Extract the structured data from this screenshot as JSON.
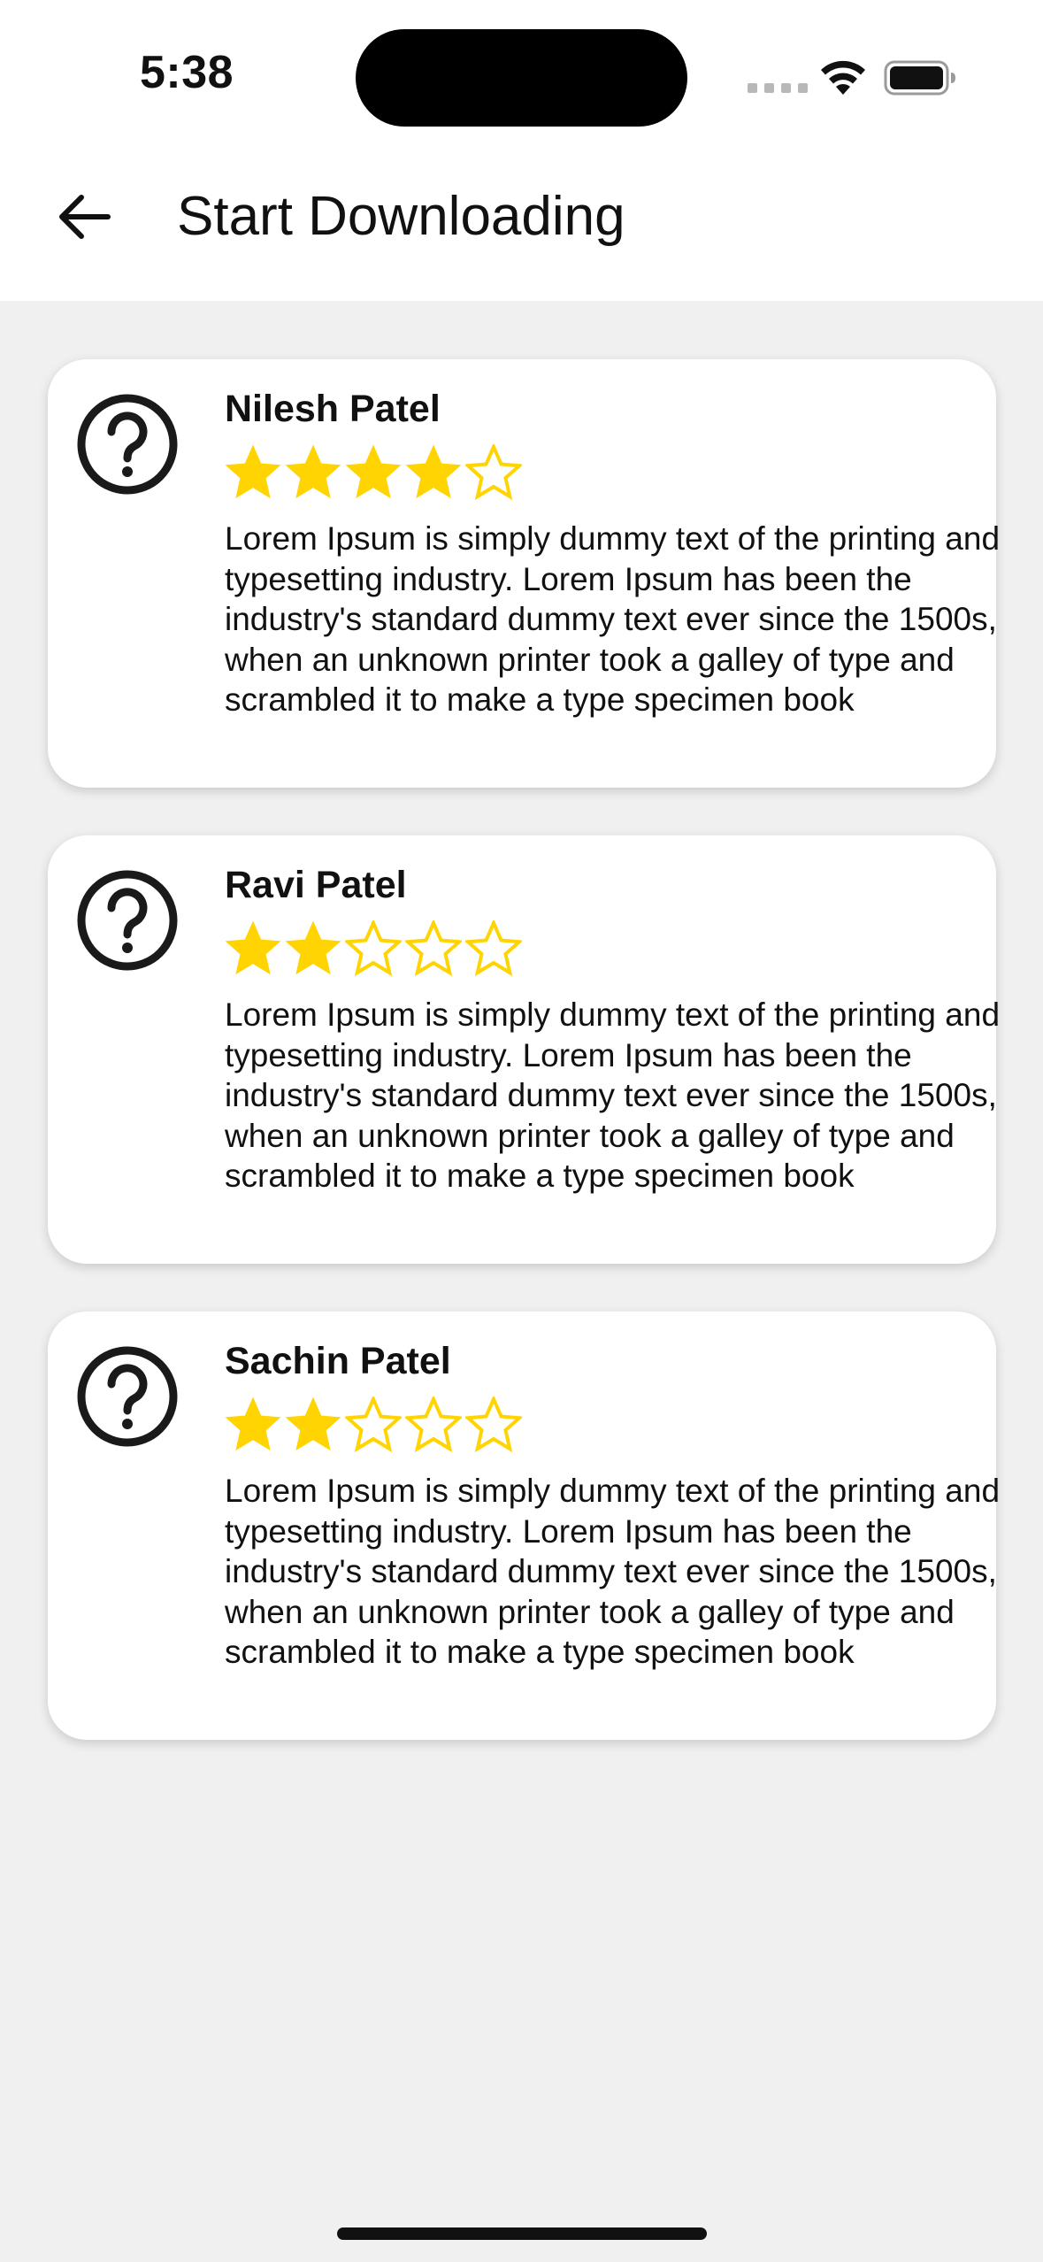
{
  "status_bar": {
    "time": "5:38",
    "icons": [
      "signal-icon",
      "wifi-icon",
      "battery-icon"
    ]
  },
  "app_bar": {
    "back_icon": "back-arrow-icon",
    "title": "Start Downloading"
  },
  "colors": {
    "background": "#f0f0f0",
    "card": "#ffffff",
    "star_filled": "#FFD400",
    "star_outline": "#FFD400",
    "text": "#111111"
  },
  "reviews": [
    {
      "name": "Nilesh Patel",
      "rating": 4,
      "max_rating": 5,
      "avatar_icon": "question-mark-icon",
      "text": "Lorem Ipsum is simply dummy text of the printing and typesetting industry. Lorem Ipsum has been the industry's standard dummy text ever since the 1500s, when an unknown printer took a galley of type and scrambled it to make a type specimen book"
    },
    {
      "name": "Ravi Patel",
      "rating": 2,
      "max_rating": 5,
      "avatar_icon": "question-mark-icon",
      "text": "Lorem Ipsum is simply dummy text of the printing and typesetting industry. Lorem Ipsum has been the industry's standard dummy text ever since the 1500s, when an unknown printer took a galley of type and scrambled it to make a type specimen book"
    },
    {
      "name": "Sachin Patel",
      "rating": 2,
      "max_rating": 5,
      "avatar_icon": "question-mark-icon",
      "text": "Lorem Ipsum is simply dummy text of the printing and typesetting industry. Lorem Ipsum has been the industry's standard dummy text ever since the 1500s, when an unknown printer took a galley of type and scrambled it to make a type specimen book"
    }
  ]
}
